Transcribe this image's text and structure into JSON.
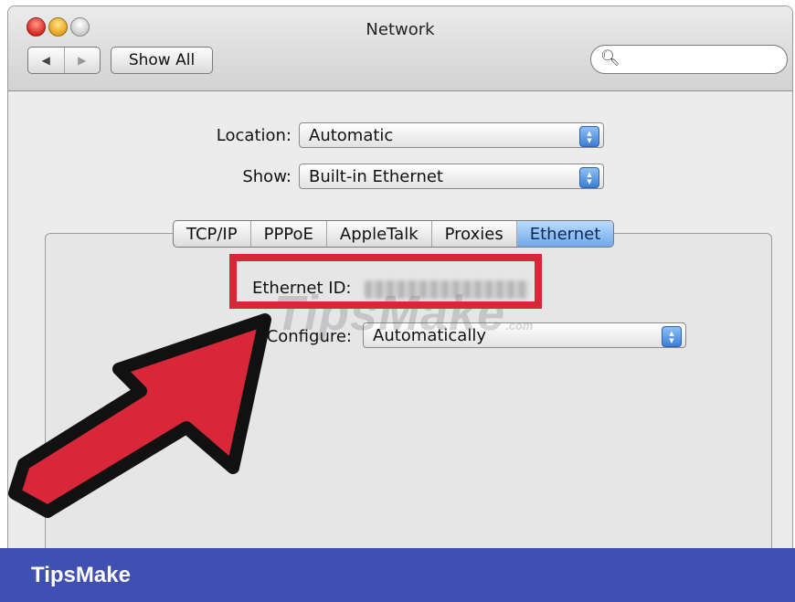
{
  "window": {
    "title": "Network",
    "show_all_label": "Show All",
    "search_placeholder": "",
    "back_icon": "◀",
    "forward_icon": "▶"
  },
  "location": {
    "label": "Location:",
    "value": "Automatic"
  },
  "show": {
    "label": "Show:",
    "value": "Built-in Ethernet"
  },
  "tabs": [
    {
      "label": "TCP/IP",
      "active": false
    },
    {
      "label": "PPPoE",
      "active": false
    },
    {
      "label": "AppleTalk",
      "active": false
    },
    {
      "label": "Proxies",
      "active": false
    },
    {
      "label": "Ethernet",
      "active": true
    }
  ],
  "ethernet": {
    "id_label": "Ethernet ID:",
    "configure_label": "Configure:",
    "configure_value": "Automatically"
  },
  "watermark": {
    "text": "TipsMake",
    "suffix": ".com"
  },
  "footer": {
    "brand": "TipsMake"
  },
  "colors": {
    "highlight_red": "#d9273a",
    "footer_blue": "#3f4fb2",
    "active_tab_blue": "#6fa8ea"
  }
}
